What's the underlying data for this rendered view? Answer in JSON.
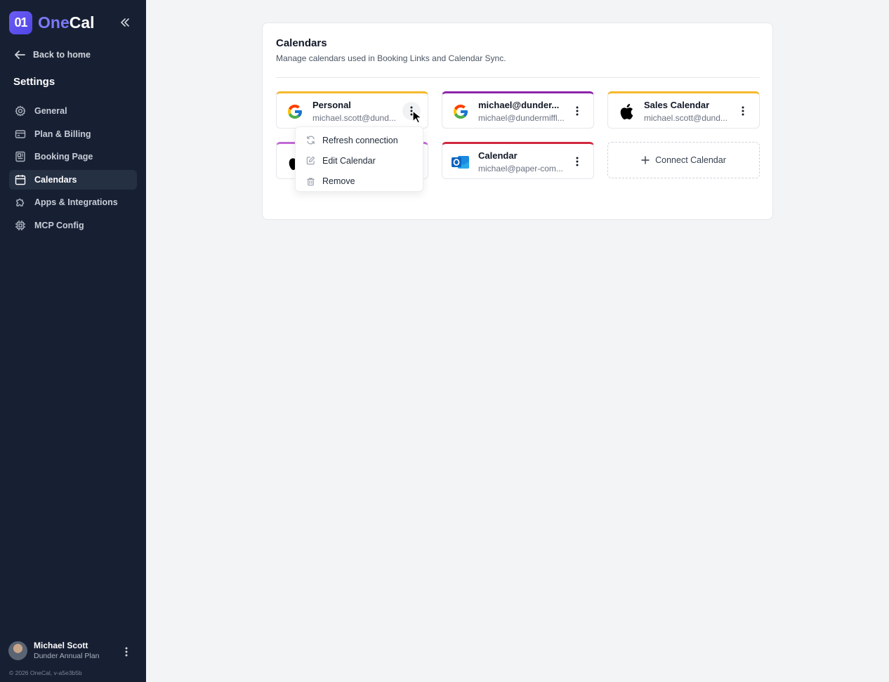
{
  "app": {
    "logo_mark": "01",
    "logo_one": "One",
    "logo_cal": "Cal"
  },
  "sidebar": {
    "back_label": "Back to home",
    "section_title": "Settings",
    "items": [
      {
        "label": "General",
        "icon": "gear-icon",
        "active": false
      },
      {
        "label": "Plan & Billing",
        "icon": "credit-card-icon",
        "active": false
      },
      {
        "label": "Booking Page",
        "icon": "booking-page-icon",
        "active": false
      },
      {
        "label": "Calendars",
        "icon": "calendar-icon",
        "active": true
      },
      {
        "label": "Apps & Integrations",
        "icon": "puzzle-icon",
        "active": false
      },
      {
        "label": "MCP Config",
        "icon": "chip-icon",
        "active": false
      }
    ],
    "user": {
      "name": "Michael Scott",
      "plan": "Dunder Annual Plan"
    },
    "footer": "© 2026 OneCal, v-a5e3b5b"
  },
  "main": {
    "title": "Calendars",
    "description": "Manage calendars used in Booking Links and Calendar Sync.",
    "calendars": [
      {
        "name": "Personal",
        "email": "michael.scott@dund...",
        "provider": "google-icon",
        "color": "#f5b82e"
      },
      {
        "name": "michael@dunder...",
        "email": "michael@dundermiffl...",
        "provider": "google-icon",
        "color": "#8e24aa"
      },
      {
        "name": "Sales Calendar",
        "email": "michael.scott@dund...",
        "provider": "apple-icon",
        "color": "#f5b82e"
      },
      {
        "name": "",
        "email": "",
        "provider": "apple-icon",
        "color": "#c26ad6"
      },
      {
        "name": "Calendar",
        "email": "michael@paper-com...",
        "provider": "outlook-icon",
        "color": "#d0283f"
      }
    ],
    "connect_label": "Connect Calendar"
  },
  "menu": {
    "items": [
      {
        "label": "Refresh connection",
        "icon": "refresh-icon"
      },
      {
        "label": "Edit Calendar",
        "icon": "edit-icon"
      },
      {
        "label": "Remove",
        "icon": "trash-icon"
      }
    ]
  }
}
